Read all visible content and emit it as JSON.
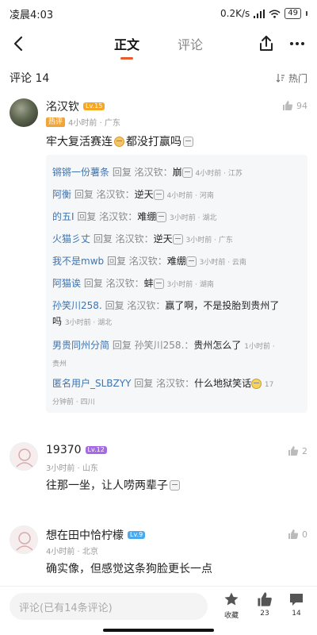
{
  "status_bar": {
    "time": "凌晨4:03",
    "network": "0.2K/s",
    "battery": "49"
  },
  "nav": {
    "tabs": [
      "正文",
      "评论"
    ],
    "active_tab": 0
  },
  "comments_header": {
    "title": "评论 14",
    "sort_label": "热门"
  },
  "comments": [
    {
      "name": "洺汉钦",
      "level": "Lv.15",
      "hot_tag": "热评",
      "meta": "4小时前 · 广东",
      "text_before": "牢大复活赛连",
      "text_after": "都没打赢吗",
      "likes": "94"
    },
    {
      "name": "19370",
      "level": "Lv.12",
      "meta": "3小时前 · 山东",
      "text": "往那一坐，让人唠两辈子",
      "likes": "2"
    },
    {
      "name": "想在田中恰柠檬",
      "level": "Lv.9",
      "meta": "4小时前 · 北京",
      "text": "确实像，但感觉这条狗脸更长一点",
      "likes": "0"
    }
  ],
  "replies": [
    {
      "name": "锵锵一份薯条",
      "reply_to": "回复 洺汉钦：",
      "text": "崩",
      "meta": "4小时前 · 江苏"
    },
    {
      "name": "阿衡",
      "reply_to": "回复 洺汉钦：",
      "text": "逆天",
      "meta": "4小时前 · 河南"
    },
    {
      "name": "的五I",
      "reply_to": "回复 洺汉钦：",
      "text": "难绷",
      "meta": "3小时前 · 湖北"
    },
    {
      "name": "火猫彡丈",
      "reply_to": "回复 洺汉钦：",
      "text": "逆天",
      "meta": "3小时前 · 广东"
    },
    {
      "name": "我不是mwb",
      "reply_to": "回复 洺汉钦：",
      "text": "难绷",
      "meta": "3小时前 · 云南"
    },
    {
      "name": "阿猫诶",
      "reply_to": "回复 洺汉钦：",
      "text": "蚌",
      "meta": "3小时前 · 湖南"
    },
    {
      "name": "孙笑川258.",
      "reply_to": "回复 洺汉钦：",
      "text_line1": "赢了啊，不是投胎到贵州了",
      "text_line2": "吗",
      "meta": "3小时前 · 湖北"
    },
    {
      "name": "男贵同州分简",
      "reply_to": "回复 孙笑川258.：",
      "text": "贵州怎么了",
      "meta_line1": "1小时前 ·",
      "meta_line2": "贵州"
    },
    {
      "name": "匿名用户_SLBZYY",
      "reply_to": "回复 洺汉钦：",
      "text": "什么地狱笑话",
      "meta_line1": "17",
      "meta_line2": "分钟前 · 四川"
    }
  ],
  "bottom_bar": {
    "input_placeholder": "评论(已有14条评论)",
    "favorite_label": "收藏",
    "like_count": "23",
    "comment_count": "14"
  },
  "icons": [
    "back-icon",
    "share-icon",
    "more-icon",
    "sort-icon",
    "thumb-up-icon",
    "star-icon",
    "comment-icon",
    "wifi-icon",
    "signal-icon"
  ],
  "colors": {
    "accent": "#e85c2c",
    "reply_name": "#3d74b0",
    "hot_tag": "#f0a53b"
  }
}
